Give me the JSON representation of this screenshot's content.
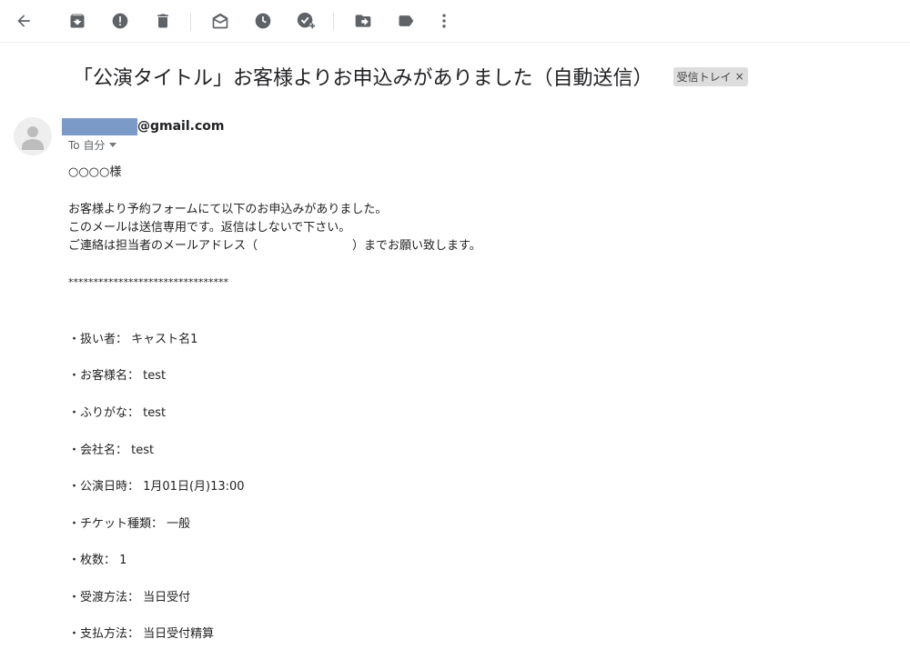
{
  "toolbar": {
    "buttons": [
      {
        "name": "back-arrow-icon"
      },
      {
        "name": "archive-icon"
      },
      {
        "name": "report-spam-icon"
      },
      {
        "name": "delete-icon"
      },
      {
        "name": "mark-unread-icon"
      },
      {
        "name": "snooze-icon"
      },
      {
        "name": "add-to-tasks-icon"
      },
      {
        "name": "move-to-icon"
      },
      {
        "name": "label-icon"
      },
      {
        "name": "more-vert-icon"
      }
    ]
  },
  "email": {
    "subject": "「公演タイトル」お客様よりお申込みがありました（自動送信）",
    "label_chip": "受信トレイ",
    "label_chip_close": "×",
    "sender_domain": "@gmail.com",
    "recipient": "To 自分",
    "body": {
      "greeting": "○○○○様",
      "intro_1": "お客様より予約フォームにて以下のお申込みがありました。",
      "intro_2": "このメールは送信専用です。返信はしないで下さい。",
      "intro_3": "ご連絡は担当者のメールアドレス（　　　　　　　　）までお願い致します。",
      "separator": "********************************",
      "fields": [
        {
          "text": "・扱い者： キャスト名1"
        },
        {
          "text": "・お客様名： test"
        },
        {
          "text": "・ふりがな： test"
        },
        {
          "text": "・会社名： test"
        },
        {
          "text": "・公演日時： 1月01日(月)13:00"
        },
        {
          "text": "・チケット種類： 一般"
        },
        {
          "text": "・枚数： 1"
        },
        {
          "text": "・受渡方法： 当日受付"
        },
        {
          "text": "・支払方法： 当日受付精算"
        }
      ]
    }
  },
  "colors": {
    "icon": "#5f6368",
    "redaction": "#7c9ac8",
    "chip_bg": "#dddddd"
  }
}
